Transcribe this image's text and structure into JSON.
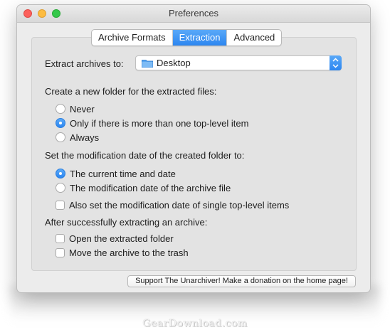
{
  "window": {
    "title": "Preferences"
  },
  "tabs": [
    {
      "label": "Archive Formats"
    },
    {
      "label": "Extraction",
      "active": true
    },
    {
      "label": "Advanced"
    }
  ],
  "extract_to": {
    "label": "Extract archives to:",
    "value": "Desktop",
    "icon": "folder-icon"
  },
  "new_folder": {
    "heading": "Create a new folder for the extracted files:",
    "options": [
      {
        "label": "Never",
        "selected": false
      },
      {
        "label": "Only if there is more than one top-level item",
        "selected": true
      },
      {
        "label": "Always",
        "selected": false
      }
    ]
  },
  "mod_date": {
    "heading": "Set the modification date of the created folder to:",
    "options": [
      {
        "label": "The current time and date",
        "selected": true
      },
      {
        "label": "The modification date of the archive file",
        "selected": false
      }
    ],
    "also_set": {
      "label": "Also set the modification date of single top-level items",
      "checked": false
    }
  },
  "after": {
    "heading": "After successfully extracting an archive:",
    "options": [
      {
        "label": "Open the extracted folder",
        "checked": false
      },
      {
        "label": "Move the archive to the trash",
        "checked": false
      }
    ]
  },
  "donate_button": {
    "label": "Support The Unarchiver! Make a donation on the home page!"
  },
  "watermark": "GearDownload.com",
  "colors": {
    "accent": "#2c86f0",
    "close": "#fc605c",
    "minimize": "#fdbc40",
    "zoom": "#34c84a"
  }
}
